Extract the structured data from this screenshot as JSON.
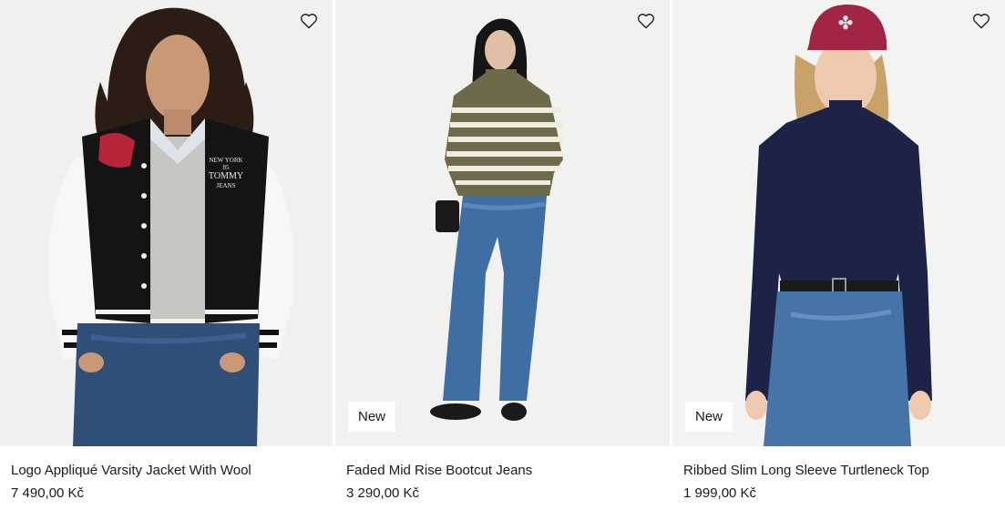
{
  "products": [
    {
      "name": "Logo Appliqué Varsity Jacket With Wool",
      "price": "7 490,00 Kč",
      "badge": "",
      "image_icon": "product-photo-varsity-jacket"
    },
    {
      "name": "Faded Mid Rise Bootcut Jeans",
      "price": "3 290,00 Kč",
      "badge": "New",
      "image_icon": "product-photo-bootcut-jeans"
    },
    {
      "name": "Ribbed Slim Long Sleeve Turtleneck Top",
      "price": "1 999,00 Kč",
      "badge": "New",
      "image_icon": "product-photo-turtleneck-top"
    }
  ],
  "wishlist_icon": "heart-icon",
  "jacket_lettering": {
    "line1": "NEW YORK",
    "line2": "85",
    "line3": "TOMMY",
    "line4": "JEANS"
  },
  "colors": {
    "photo_background": "#efefed",
    "text": "#1a1a1a",
    "badge_background": "#ffffff"
  }
}
